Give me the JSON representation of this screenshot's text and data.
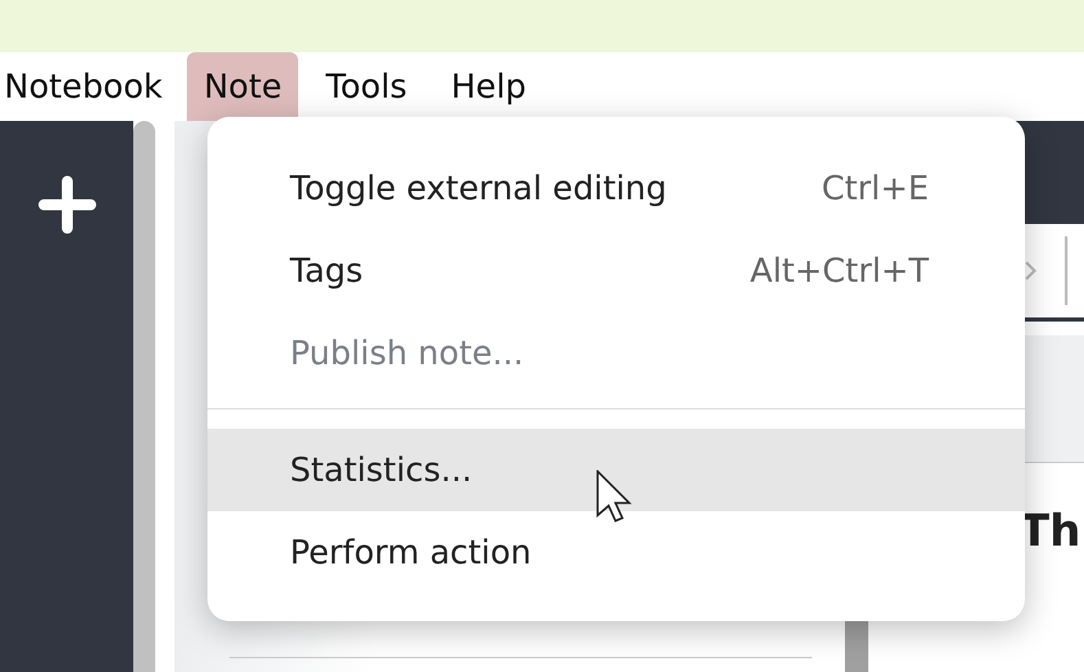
{
  "menu_bar": [
    {
      "label": "Notebook",
      "selected": false
    },
    {
      "label": "Note",
      "selected": true
    },
    {
      "label": "Tools",
      "selected": false
    },
    {
      "label": "Help",
      "selected": false
    }
  ],
  "note_heading": "Th",
  "dropdown": {
    "items": [
      {
        "kind": "item",
        "label": "Toggle external editing",
        "shortcut": "Ctrl+E",
        "disabled": false,
        "highlighted": false
      },
      {
        "kind": "item",
        "label": "Tags",
        "shortcut": "Alt+Ctrl+T",
        "disabled": false,
        "highlighted": false
      },
      {
        "kind": "item",
        "label": "Publish note...",
        "disabled": true,
        "highlighted": false
      },
      {
        "kind": "separator"
      },
      {
        "kind": "item",
        "label": "Statistics...",
        "disabled": false,
        "highlighted": true
      },
      {
        "kind": "item",
        "label": "Perform action",
        "disabled": false,
        "highlighted": false
      }
    ]
  }
}
